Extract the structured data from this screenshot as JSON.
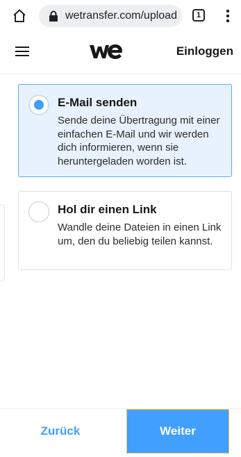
{
  "browser": {
    "url": "wetransfer.com/upload",
    "tab_count": "1",
    "icons": [
      "home-icon",
      "lock-icon",
      "tabs-icon",
      "more-menu-icon"
    ]
  },
  "header": {
    "logo_alt": "we",
    "login_label": "Einloggen",
    "icons": [
      "hamburger-menu-icon"
    ]
  },
  "options": [
    {
      "title": "E-Mail senden",
      "description": "Sende deine Übertragung mit einer einfachen E-Mail und wir werden dich informieren, wenn sie heruntergeladen worden ist.",
      "selected": true
    },
    {
      "title": "Hol dir einen Link",
      "description": "Wandle deine Dateien in einen Link um, den du beliebig teilen kannst.",
      "selected": false
    }
  ],
  "footer": {
    "back_label": "Zurück",
    "next_label": "Weiter"
  },
  "colors": {
    "accent": "#409fff",
    "selected_bg": "#e8f2fc",
    "selected_border": "#5fa8ee"
  }
}
